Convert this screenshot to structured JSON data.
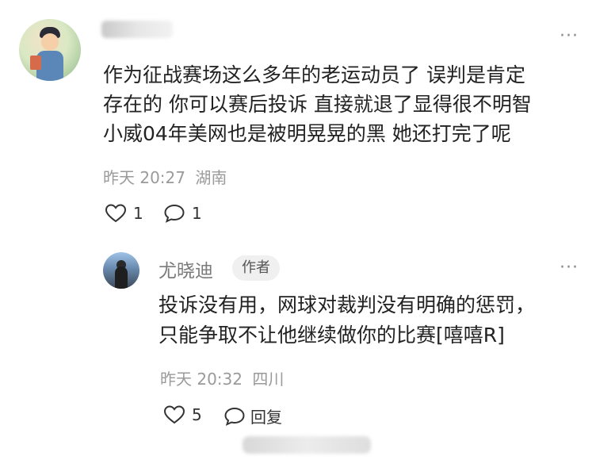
{
  "comment1": {
    "author_name": "",
    "lines": [
      "作为征战赛场这么多年的老运动员了 误判是肯定",
      "存在的 你可以赛后投诉 直接就退了显得很不明智",
      "小威04年美网也是被明晃晃的黑 她还打完了呢"
    ],
    "time": "昨天 20:27",
    "location": "湖南",
    "like_count": "1",
    "reply_count": "1",
    "more": "···"
  },
  "reply1": {
    "author_name": "尤晓迪",
    "author_badge": "作者",
    "lines": [
      "投诉没有用，网球对裁判没有明确的惩罚，",
      "只能争取不让他继续做你的比赛[嘻嘻R]"
    ],
    "time": "昨天 20:32",
    "location": "四川",
    "like_count": "5",
    "reply_label": "回复",
    "more": "···"
  },
  "icons": {
    "like": "heart-outline-icon",
    "comment": "speech-bubble-icon",
    "more": "more-dots-icon"
  }
}
